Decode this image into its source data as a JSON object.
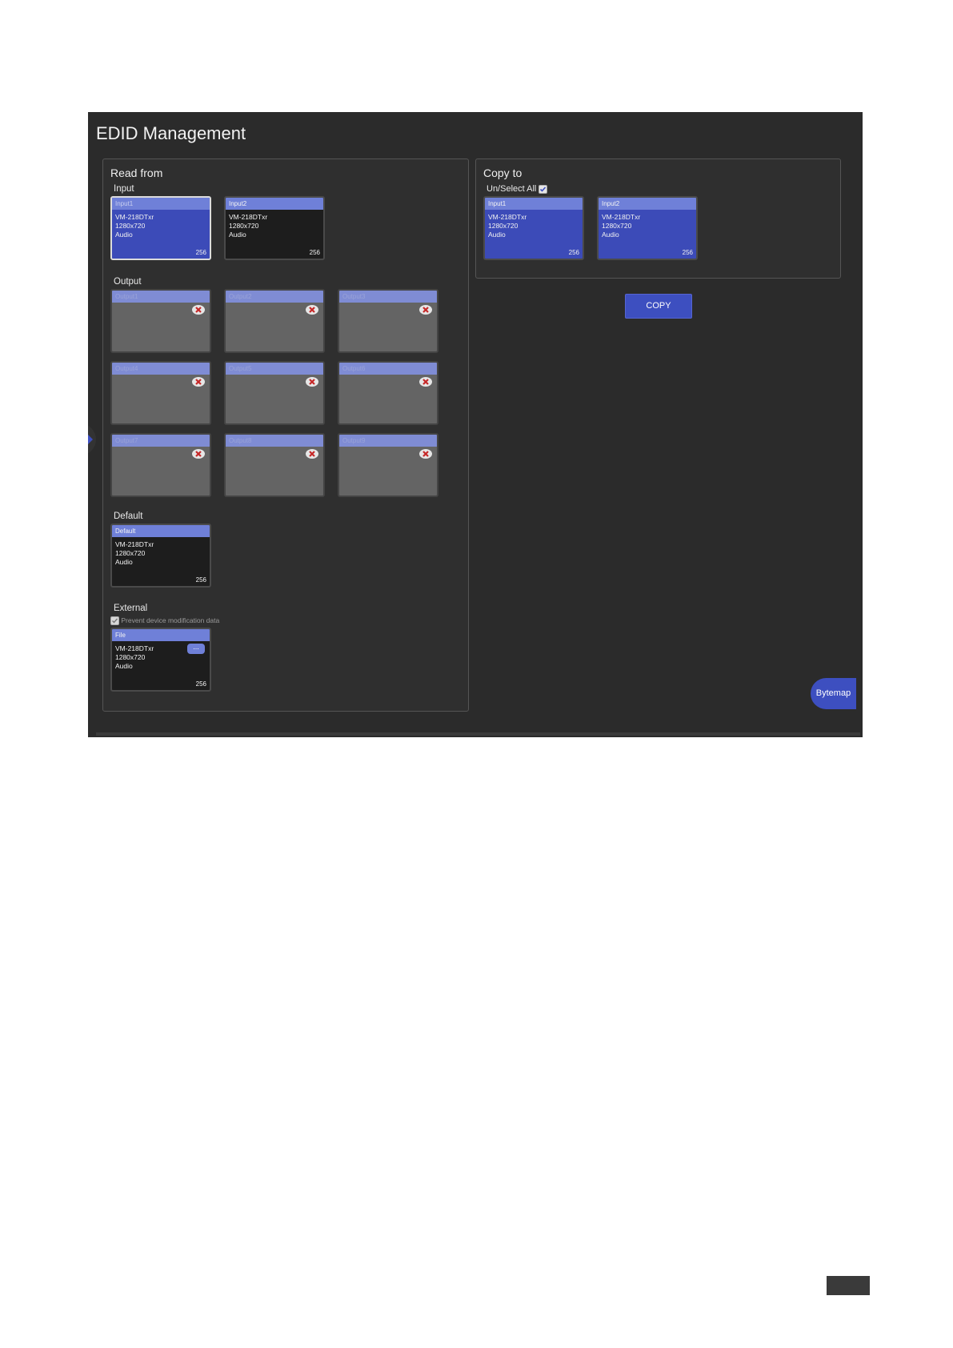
{
  "title": "EDID Management",
  "read_from": {
    "title": "Read from",
    "input_label": "Input",
    "inputs": [
      {
        "name": "Input1",
        "lines": [
          "VM-218DTxr",
          "1280x720",
          "Audio"
        ],
        "size": "256"
      },
      {
        "name": "Input2",
        "lines": [
          "VM-218DTxr",
          "1280x720",
          "Audio"
        ],
        "size": "256"
      }
    ],
    "output_label": "Output",
    "outputs": [
      "Output1",
      "Output2",
      "Output3",
      "Output4",
      "Output5",
      "Output6",
      "Output7",
      "Output8",
      "Output9"
    ],
    "default_label": "Default",
    "default_card": {
      "name": "Default",
      "lines": [
        "VM-218DTxr",
        "1280x720",
        "Audio"
      ],
      "size": "256"
    },
    "external_label": "External",
    "prevent_label": "Prevent device modification data",
    "file_card": {
      "name": "File",
      "lines": [
        "VM-218DTxr",
        "1280x720",
        "Audio"
      ],
      "size": "256",
      "browse": "..."
    }
  },
  "copy_to": {
    "title": "Copy to",
    "select_all_label": "Un/Select All",
    "select_all_checked": true,
    "inputs": [
      {
        "name": "Input1",
        "lines": [
          "VM-218DTxr",
          "1280x720",
          "Audio"
        ],
        "size": "256"
      },
      {
        "name": "Input2",
        "lines": [
          "VM-218DTxr",
          "1280x720",
          "Audio"
        ],
        "size": "256"
      }
    ]
  },
  "copy_button": "COPY",
  "bytemap_button": "Bytemap",
  "colors": {
    "background": "#2b2b2b",
    "accent": "#3d4fc0",
    "card_header": "#6f80d8"
  }
}
